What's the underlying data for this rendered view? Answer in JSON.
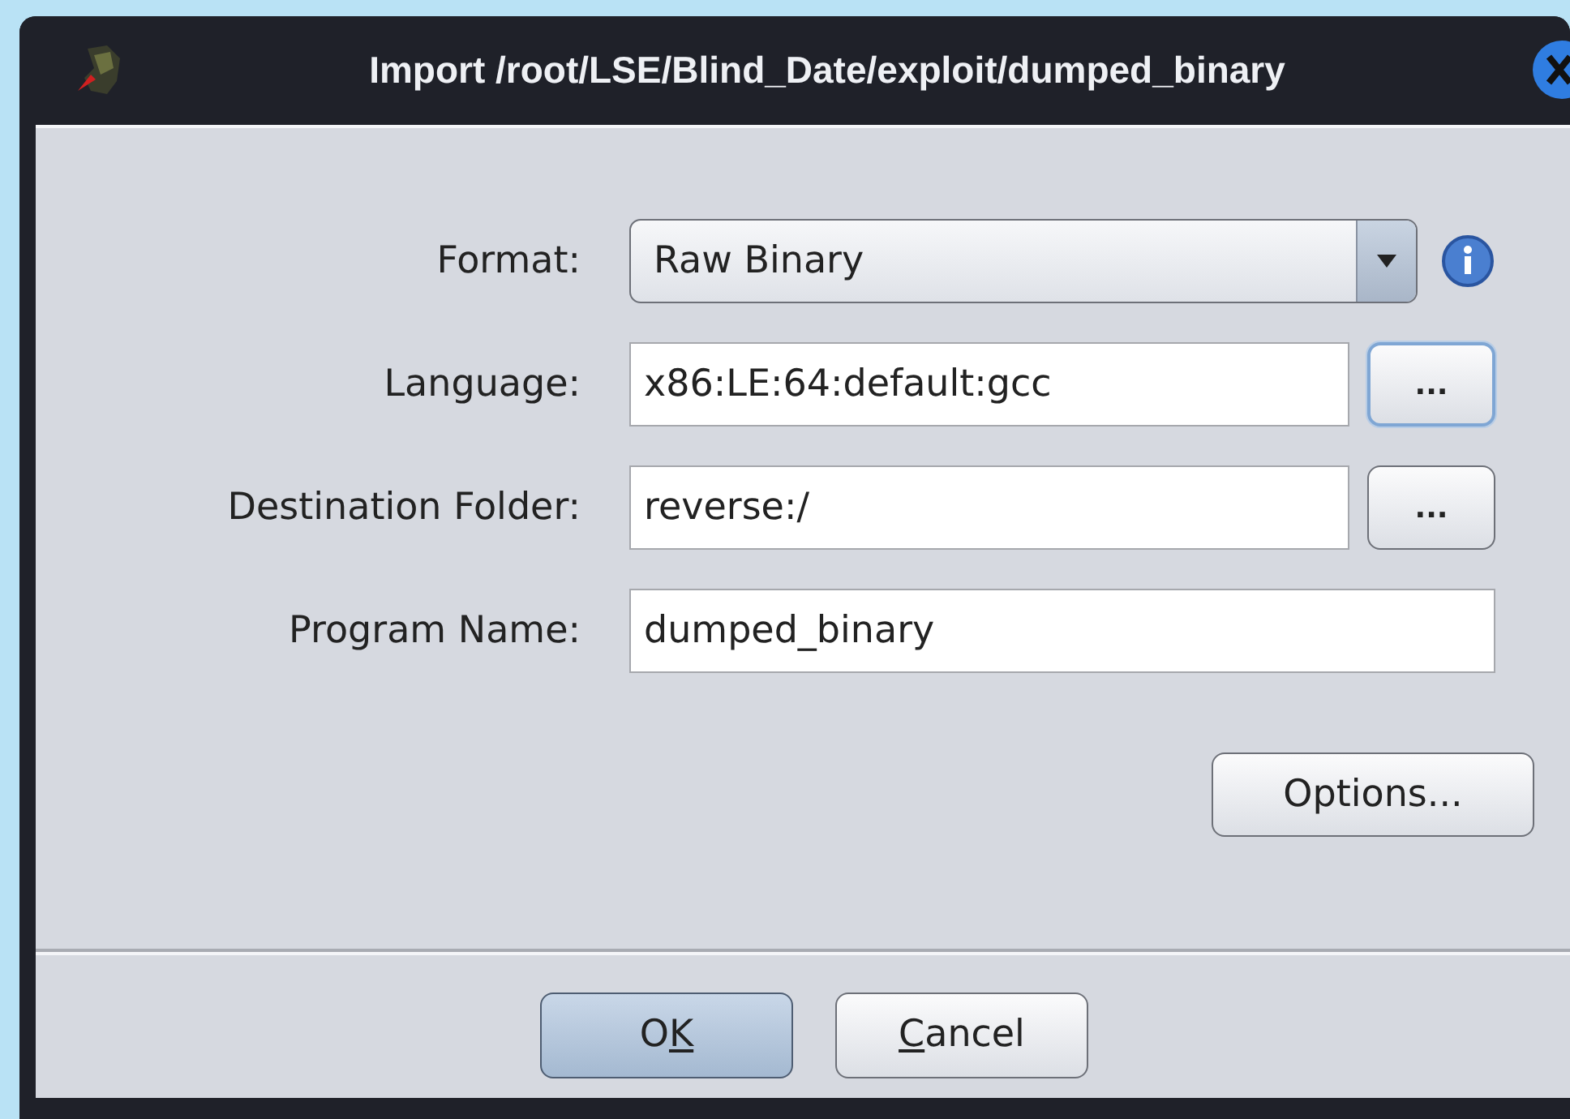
{
  "window": {
    "title": "Import /root/LSE/Blind_Date/exploit/dumped_binary"
  },
  "fields": [
    {
      "kind": "combo",
      "label": "Format:",
      "value": "Raw Binary"
    },
    {
      "kind": "browse",
      "label": "Language:",
      "value": "x86:LE:64:default:gcc",
      "button": "...",
      "focused": true
    },
    {
      "kind": "browse",
      "label": "Destination Folder:",
      "value": "reverse:/",
      "button": "...",
      "focused": false
    },
    {
      "kind": "text",
      "label": "Program Name:",
      "value": "dumped_binary"
    }
  ],
  "options_button": "Options...",
  "buttons": [
    {
      "label_parts": [
        {
          "text": "O",
          "underlined": false
        },
        {
          "text": "K",
          "underlined": true
        }
      ],
      "default": true
    },
    {
      "label_parts": [
        {
          "text": "C",
          "underlined": true
        },
        {
          "text": "ancel",
          "underlined": false
        }
      ],
      "default": false
    }
  ]
}
